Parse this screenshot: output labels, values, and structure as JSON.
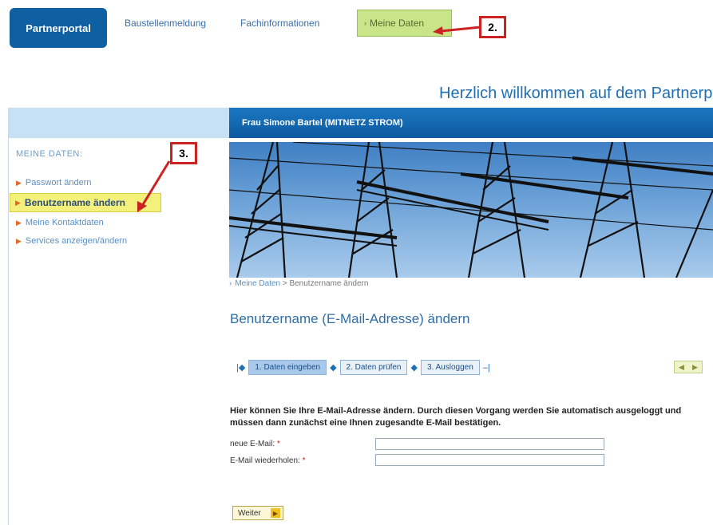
{
  "nav": {
    "tabs": [
      {
        "label": "Partnerportal"
      },
      {
        "label": "Baustellenmeldung"
      },
      {
        "label": "Fachinformationen"
      },
      {
        "label": "Meine Daten"
      }
    ]
  },
  "annotations": {
    "callout_2": "2.",
    "callout_3": "3."
  },
  "welcome": "Herzlich willkommen auf dem Partnerp",
  "user_bar": "Frau Simone Bartel (MITNETZ STROM)",
  "sidebar": {
    "heading": "MEINE DATEN:",
    "items": [
      {
        "label": "Passwort ändern"
      },
      {
        "label": "Benutzername ändern"
      },
      {
        "label": "Meine Kontaktdaten"
      },
      {
        "label": "Services anzeigen/ändern"
      }
    ]
  },
  "breadcrumb": {
    "root": "Meine Daten",
    "sep": " > ",
    "current": "Benutzername ändern"
  },
  "page_title": "Benutzername (E-Mail-Adresse) ändern",
  "steps": [
    {
      "label": "1. Daten eingeben"
    },
    {
      "label": "2. Daten prüfen"
    },
    {
      "label": "3. Ausloggen"
    }
  ],
  "form": {
    "intro": "Hier können Sie Ihre E-Mail-Adresse ändern. Durch diesen Vorgang werden Sie automatisch ausgeloggt und müssen dann zunächst eine Ihnen zugesandte E-Mail bestätigen.",
    "email_label": "neue E-Mail:",
    "email_repeat_label": "E-Mail wiederholen:",
    "required_mark": "*",
    "email_value": "",
    "email_repeat_value": "",
    "submit_label": "Weiter"
  },
  "colors": {
    "brand_blue": "#0f5fa3",
    "highlight_green": "#c9e58a",
    "highlight_yellow": "#f4f07c",
    "callout_red": "#cc2222"
  }
}
